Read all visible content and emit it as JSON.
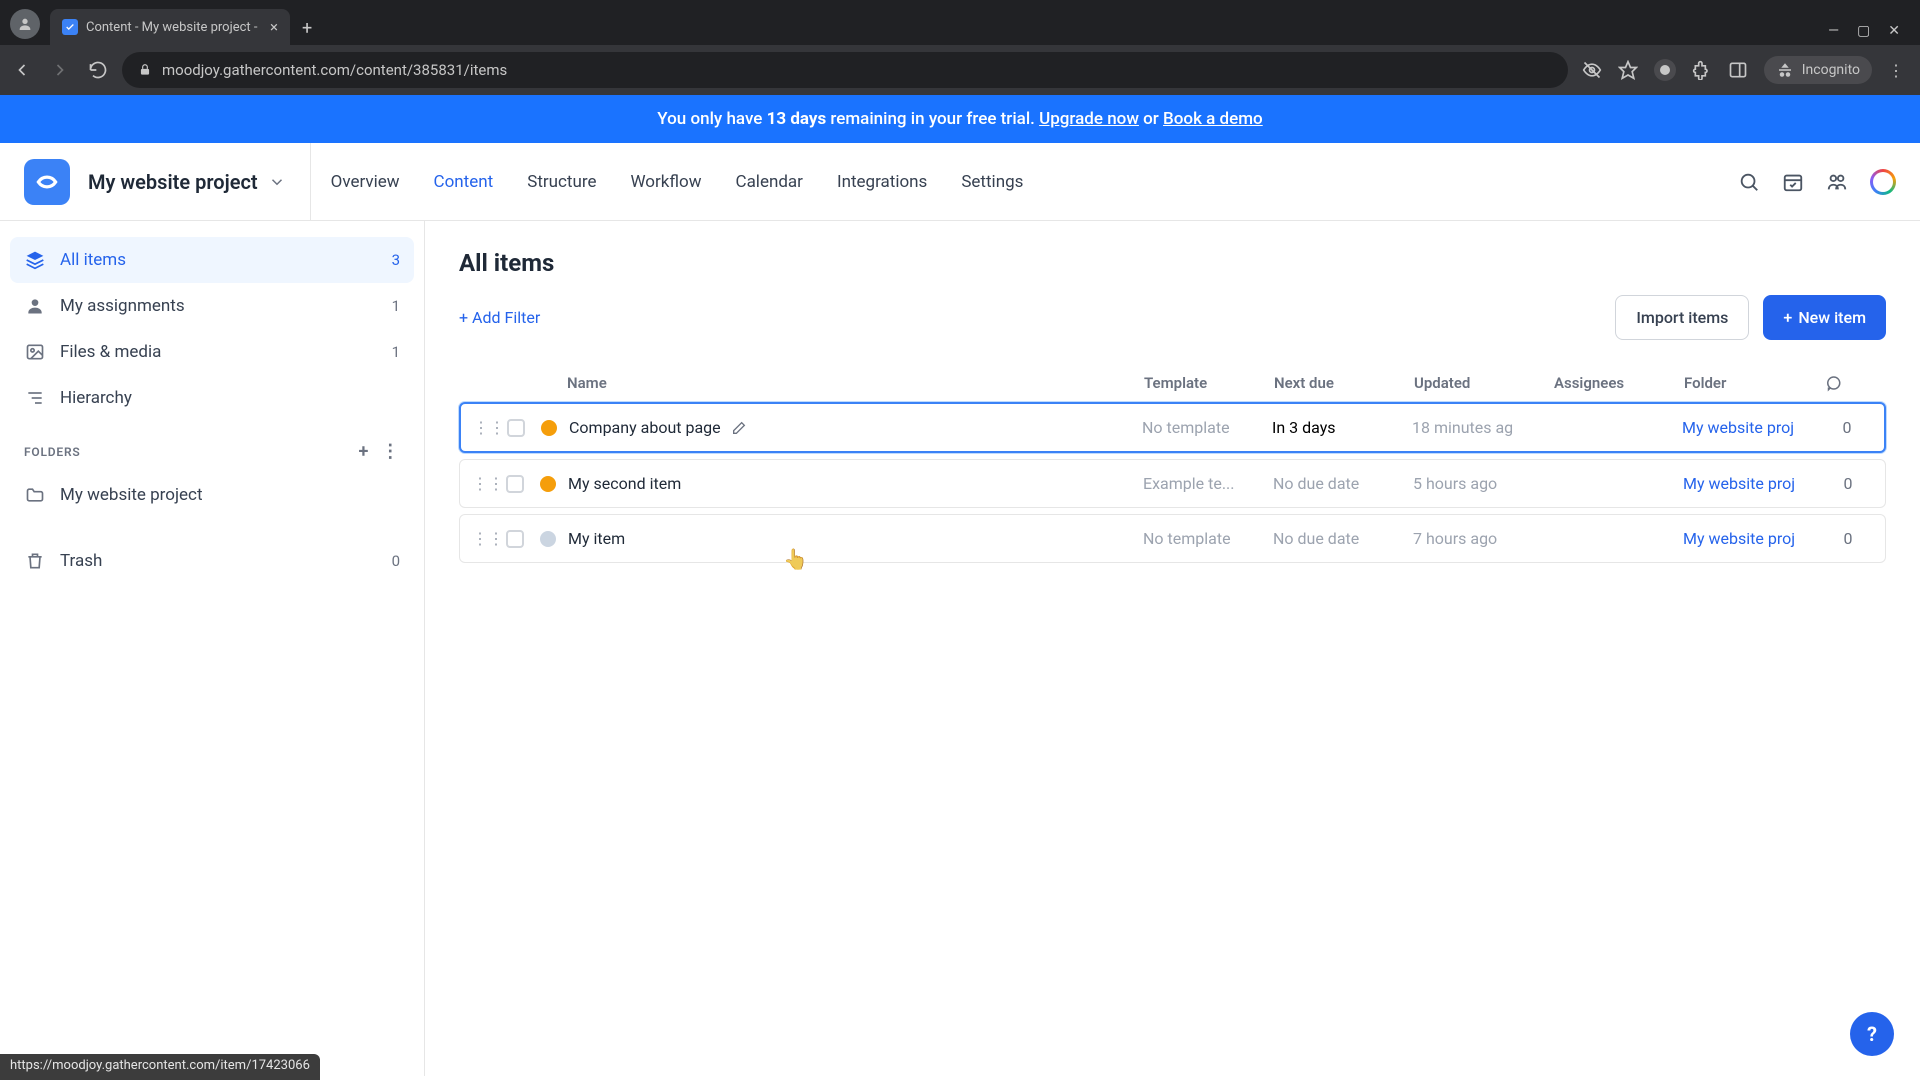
{
  "browser": {
    "tab_title": "Content - My website project -",
    "url": "moodjoy.gathercontent.com/content/385831/items",
    "incognito_label": "Incognito"
  },
  "banner": {
    "prefix": "You only have ",
    "days": "13 days",
    "mid": " remaining in your free trial. ",
    "upgrade": "Upgrade now",
    "or": " or ",
    "demo": "Book a demo"
  },
  "header": {
    "project_name": "My website project",
    "nav": {
      "overview": "Overview",
      "content": "Content",
      "structure": "Structure",
      "workflow": "Workflow",
      "calendar": "Calendar",
      "integrations": "Integrations",
      "settings": "Settings"
    }
  },
  "sidebar": {
    "all_items": {
      "label": "All items",
      "count": "3"
    },
    "my_assignments": {
      "label": "My assignments",
      "count": "1"
    },
    "files_media": {
      "label": "Files & media",
      "count": "1"
    },
    "hierarchy": {
      "label": "Hierarchy"
    },
    "folders_title": "FOLDERS",
    "folder_1": {
      "label": "My website project"
    },
    "trash": {
      "label": "Trash",
      "count": "0"
    }
  },
  "main": {
    "title": "All items",
    "add_filter": "+ Add Filter",
    "import_items": "Import items",
    "new_item": "New item",
    "columns": {
      "name": "Name",
      "template": "Template",
      "next_due": "Next due",
      "updated": "Updated",
      "assignees": "Assignees",
      "folder": "Folder"
    },
    "rows": [
      {
        "name": "Company about page",
        "template": "No template",
        "due": "In 3 days",
        "updated": "18 minutes ag",
        "has_assignee": true,
        "folder": "My website proj",
        "comments": "0",
        "status": "orange",
        "hovered": true,
        "show_edit": true
      },
      {
        "name": "My second item",
        "template": "Example te...",
        "due": "No due date",
        "updated": "5 hours ago",
        "has_assignee": false,
        "folder": "My website proj",
        "comments": "0",
        "status": "orange",
        "hovered": false,
        "show_edit": false
      },
      {
        "name": "My item",
        "template": "No template",
        "due": "No due date",
        "updated": "7 hours ago",
        "has_assignee": false,
        "folder": "My website proj",
        "comments": "0",
        "status": "grey",
        "hovered": false,
        "show_edit": false
      }
    ]
  },
  "status_bar": "https://moodjoy.gathercontent.com/item/17423066"
}
